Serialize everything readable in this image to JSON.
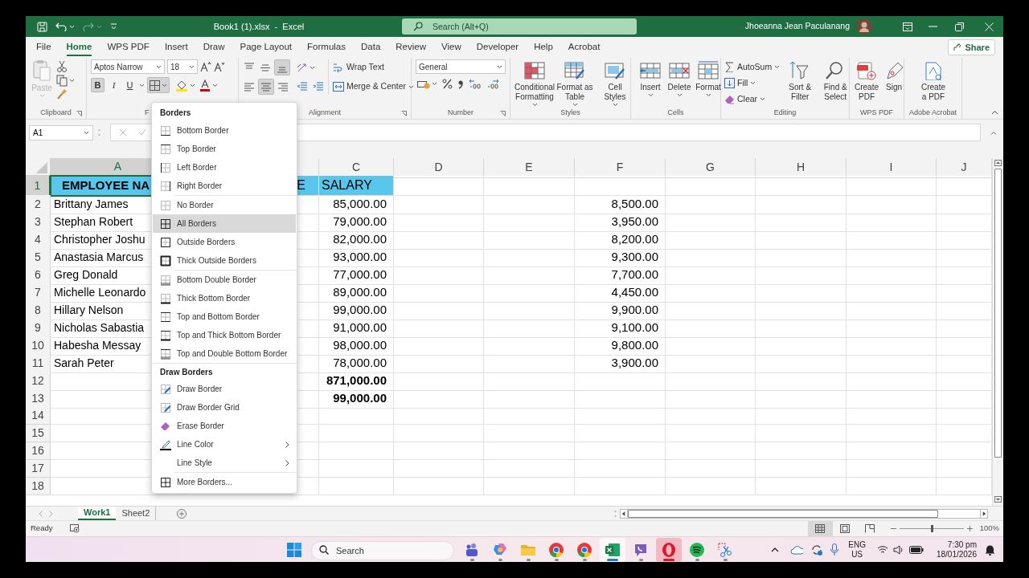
{
  "title_bar": {
    "document_title": "Book1 (1).xlsx  -  Excel",
    "search": {
      "placeholder": "Search (Alt+Q)"
    },
    "user_name": "Jhoeanna Jean Paculanang"
  },
  "menu_tabs": [
    {
      "label": "File",
      "selected": false
    },
    {
      "label": "Home",
      "selected": true
    },
    {
      "label": "WPS PDF",
      "selected": false
    },
    {
      "label": "Insert",
      "selected": false
    },
    {
      "label": "Draw",
      "selected": false
    },
    {
      "label": "Page Layout",
      "selected": false
    },
    {
      "label": "Formulas",
      "selected": false
    },
    {
      "label": "Data",
      "selected": false
    },
    {
      "label": "Review",
      "selected": false
    },
    {
      "label": "View",
      "selected": false
    },
    {
      "label": "Developer",
      "selected": false
    },
    {
      "label": "Help",
      "selected": false
    },
    {
      "label": "Acrobat",
      "selected": false
    }
  ],
  "share_button": "Share",
  "ribbon": {
    "clipboard": {
      "paste": "Paste",
      "label": "Clipboard"
    },
    "font": {
      "font_name": "Aptos Narrow",
      "font_size": "18",
      "style_buttons": [
        {
          "kind": "bold",
          "label": "B",
          "on": true
        },
        {
          "kind": "italic",
          "label": "I",
          "on": false
        },
        {
          "kind": "underline",
          "label": "U",
          "on": false
        }
      ],
      "label": "F"
    },
    "alignment": {
      "vertical_buttons": [
        {
          "kind": "top",
          "pressed": false
        },
        {
          "kind": "middle",
          "pressed": false
        },
        {
          "kind": "bottom",
          "pressed": true
        }
      ],
      "horizontal_buttons": [
        {
          "kind": "left",
          "pressed": false
        },
        {
          "kind": "center",
          "pressed": true
        },
        {
          "kind": "right",
          "pressed": false
        }
      ],
      "wrap_text": "Wrap Text",
      "merge_center": "Merge & Center",
      "label": "Alignment"
    },
    "number": {
      "format": "General",
      "label": "Number"
    },
    "styles": {
      "buttons": [
        {
          "kind": "conditional",
          "lines": [
            "Conditional",
            "Formatting"
          ]
        },
        {
          "kind": "table",
          "lines": [
            "Format as",
            "Table"
          ]
        },
        {
          "kind": "cell_styles",
          "lines": [
            "Cell",
            "Styles"
          ]
        }
      ],
      "label": "Styles"
    },
    "cells": {
      "buttons": [
        {
          "kind": "insert",
          "lines": [
            "Insert"
          ]
        },
        {
          "kind": "delete",
          "lines": [
            "Delete"
          ]
        },
        {
          "kind": "format",
          "lines": [
            "Format"
          ]
        }
      ],
      "label": "Cells"
    },
    "editing": {
      "small_buttons": [
        {
          "kind": "autosum",
          "label": "AutoSum"
        },
        {
          "kind": "fill",
          "label": "Fill"
        },
        {
          "kind": "clear",
          "label": "Clear"
        }
      ],
      "buttons": [
        {
          "kind": "sort",
          "lines": [
            "Sort &",
            "Filter"
          ]
        },
        {
          "kind": "find",
          "lines": [
            "Find &",
            "Select"
          ]
        }
      ],
      "label": "Editing"
    },
    "wps_pdf": {
      "buttons": [
        {
          "kind": "create_pdf",
          "lines": [
            "Create",
            "PDF"
          ]
        },
        {
          "kind": "sign",
          "lines": [
            "Sign"
          ]
        }
      ],
      "label": "WPS PDF"
    },
    "adobe": {
      "buttons": [
        {
          "kind": "adobe_pdf",
          "lines": [
            "Create",
            "a PDF"
          ]
        }
      ],
      "label": "Adobe Acrobat"
    }
  },
  "name_box": "A1",
  "columns": [
    {
      "label": "A",
      "selected": true
    },
    {
      "selected": false
    },
    {
      "label": "C",
      "selected": false
    },
    {
      "label": "D",
      "selected": false
    },
    {
      "label": "E",
      "selected": false
    },
    {
      "label": "F",
      "selected": false
    },
    {
      "label": "G",
      "selected": false
    },
    {
      "label": "H",
      "selected": false
    },
    {
      "label": "I",
      "selected": false
    },
    {
      "label": "J",
      "selected": false
    }
  ],
  "rows": [
    {
      "number": "1",
      "kind": "header",
      "selected": true,
      "a": "EMPLOYEE NA",
      "b": "E",
      "c": "SALARY"
    },
    {
      "number": "2",
      "kind": "data",
      "selected": false,
      "a": "Brittany James",
      "c": "85,000.00",
      "f": "8,500.00"
    },
    {
      "number": "3",
      "kind": "data",
      "selected": false,
      "a": "Stephan Robert",
      "c": "79,000.00",
      "f": "3,950.00"
    },
    {
      "number": "4",
      "kind": "data",
      "selected": false,
      "a": "Christopher Joshu",
      "c": "82,000.00",
      "f": "8,200.00"
    },
    {
      "number": "5",
      "kind": "data",
      "selected": false,
      "a": "Anastasia Marcus",
      "c": "93,000.00",
      "f": "9,300.00"
    },
    {
      "number": "6",
      "kind": "data",
      "selected": false,
      "a": "Greg Donald",
      "c": "77,000.00",
      "f": "7,700.00"
    },
    {
      "number": "7",
      "kind": "data",
      "selected": false,
      "a": "Michelle Leonardo",
      "c": "89,000.00",
      "f": "4,450.00"
    },
    {
      "number": "8",
      "kind": "data",
      "selected": false,
      "a": "Hillary Nelson",
      "c": "99,000.00",
      "f": "9,900.00"
    },
    {
      "number": "9",
      "kind": "data",
      "selected": false,
      "a": "Nicholas Sabastia",
      "c": "91,000.00",
      "f": "9,100.00"
    },
    {
      "number": "10",
      "kind": "data",
      "selected": false,
      "a": "Habesha Messay",
      "c": "98,000.00",
      "f": "9,800.00"
    },
    {
      "number": "11",
      "kind": "data",
      "selected": false,
      "a": "Sarah Peter",
      "c": "78,000.00",
      "f": "3,900.00"
    },
    {
      "number": "12",
      "kind": "total",
      "selected": false,
      "c": "871,000.00"
    },
    {
      "number": "13",
      "kind": "total",
      "selected": false,
      "c": "99,000.00"
    },
    {
      "number": "14",
      "kind": "data",
      "selected": false
    },
    {
      "number": "15",
      "kind": "data",
      "selected": false
    },
    {
      "number": "16",
      "kind": "data",
      "selected": false
    },
    {
      "number": "17",
      "kind": "data",
      "selected": false
    },
    {
      "number": "18",
      "kind": "data",
      "selected": false
    }
  ],
  "borders_menu": {
    "sections": [
      {
        "title": "Borders",
        "groups": [
          [
            {
              "kind": "bottom",
              "label": "Bottom Border",
              "hovered": false,
              "submenu": false
            },
            {
              "kind": "top",
              "label": "Top Border",
              "hovered": false,
              "submenu": false
            },
            {
              "kind": "left",
              "label": "Left Border",
              "hovered": false,
              "submenu": false
            },
            {
              "kind": "right",
              "label": "Right Border",
              "hovered": false,
              "submenu": false
            }
          ],
          [
            {
              "kind": "none",
              "label": "No Border",
              "hovered": false,
              "submenu": false
            },
            {
              "kind": "all",
              "label": "All Borders",
              "hovered": true,
              "submenu": false
            },
            {
              "kind": "outside",
              "label": "Outside Borders",
              "hovered": false,
              "submenu": false
            },
            {
              "kind": "thick_outside",
              "label": "Thick Outside Borders",
              "hovered": false,
              "submenu": false
            }
          ],
          [
            {
              "kind": "bottom_double",
              "label": "Bottom Double Border",
              "hovered": false,
              "submenu": false
            },
            {
              "kind": "thick_bottom",
              "label": "Thick Bottom Border",
              "hovered": false,
              "submenu": false
            },
            {
              "kind": "top_bottom",
              "label": "Top and Bottom Border",
              "hovered": false,
              "submenu": false
            },
            {
              "kind": "top_thick_bottom",
              "label": "Top and Thick Bottom Border",
              "hovered": false,
              "submenu": false
            },
            {
              "kind": "top_double_bottom",
              "label": "Top and Double Bottom Border",
              "hovered": false,
              "submenu": false
            }
          ]
        ]
      },
      {
        "title": "Draw Borders",
        "groups": [
          [
            {
              "kind": "draw",
              "label": "Draw Border",
              "hovered": false,
              "submenu": false
            },
            {
              "kind": "draw_grid",
              "label": "Draw Border Grid",
              "hovered": false,
              "submenu": false
            },
            {
              "kind": "erase",
              "label": "Erase Border",
              "hovered": false,
              "submenu": false
            },
            {
              "kind": "line_color",
              "label": "Line Color",
              "hovered": false,
              "submenu": true
            },
            {
              "kind": "line_style",
              "label": "Line Style",
              "hovered": false,
              "submenu": true
            }
          ],
          [
            {
              "kind": "more",
              "label": "More Borders...",
              "hovered": false,
              "submenu": false
            }
          ]
        ]
      }
    ]
  },
  "sheet_tabs": [
    {
      "label": "Work1",
      "selected": true
    },
    {
      "label": "Sheet2",
      "selected": false
    }
  ],
  "status_bar": {
    "status": "Ready",
    "views": [
      {
        "kind": "normal",
        "selected": true
      },
      {
        "kind": "page_layout",
        "selected": false
      },
      {
        "kind": "page_break",
        "selected": false
      }
    ],
    "zoom": {
      "level": 0.5,
      "reading": "100%"
    }
  },
  "taskbar": {
    "search": {
      "placeholder": "Search"
    },
    "apps": [
      {
        "kind": "teams",
        "active": false
      },
      {
        "kind": "copilot",
        "active": false
      },
      {
        "kind": "folder",
        "active": false
      },
      {
        "kind": "chrome",
        "active": false
      },
      {
        "kind": "chrome",
        "active": false
      },
      {
        "kind": "excel",
        "active": true
      },
      {
        "kind": "viber",
        "active": false
      },
      {
        "kind": "opera",
        "active": true
      },
      {
        "kind": "spotify",
        "active": false
      },
      {
        "kind": "snip",
        "active": false
      }
    ],
    "language": "ENG",
    "region": "US",
    "time": "7:30 pm",
    "date": "18/01/2026"
  }
}
